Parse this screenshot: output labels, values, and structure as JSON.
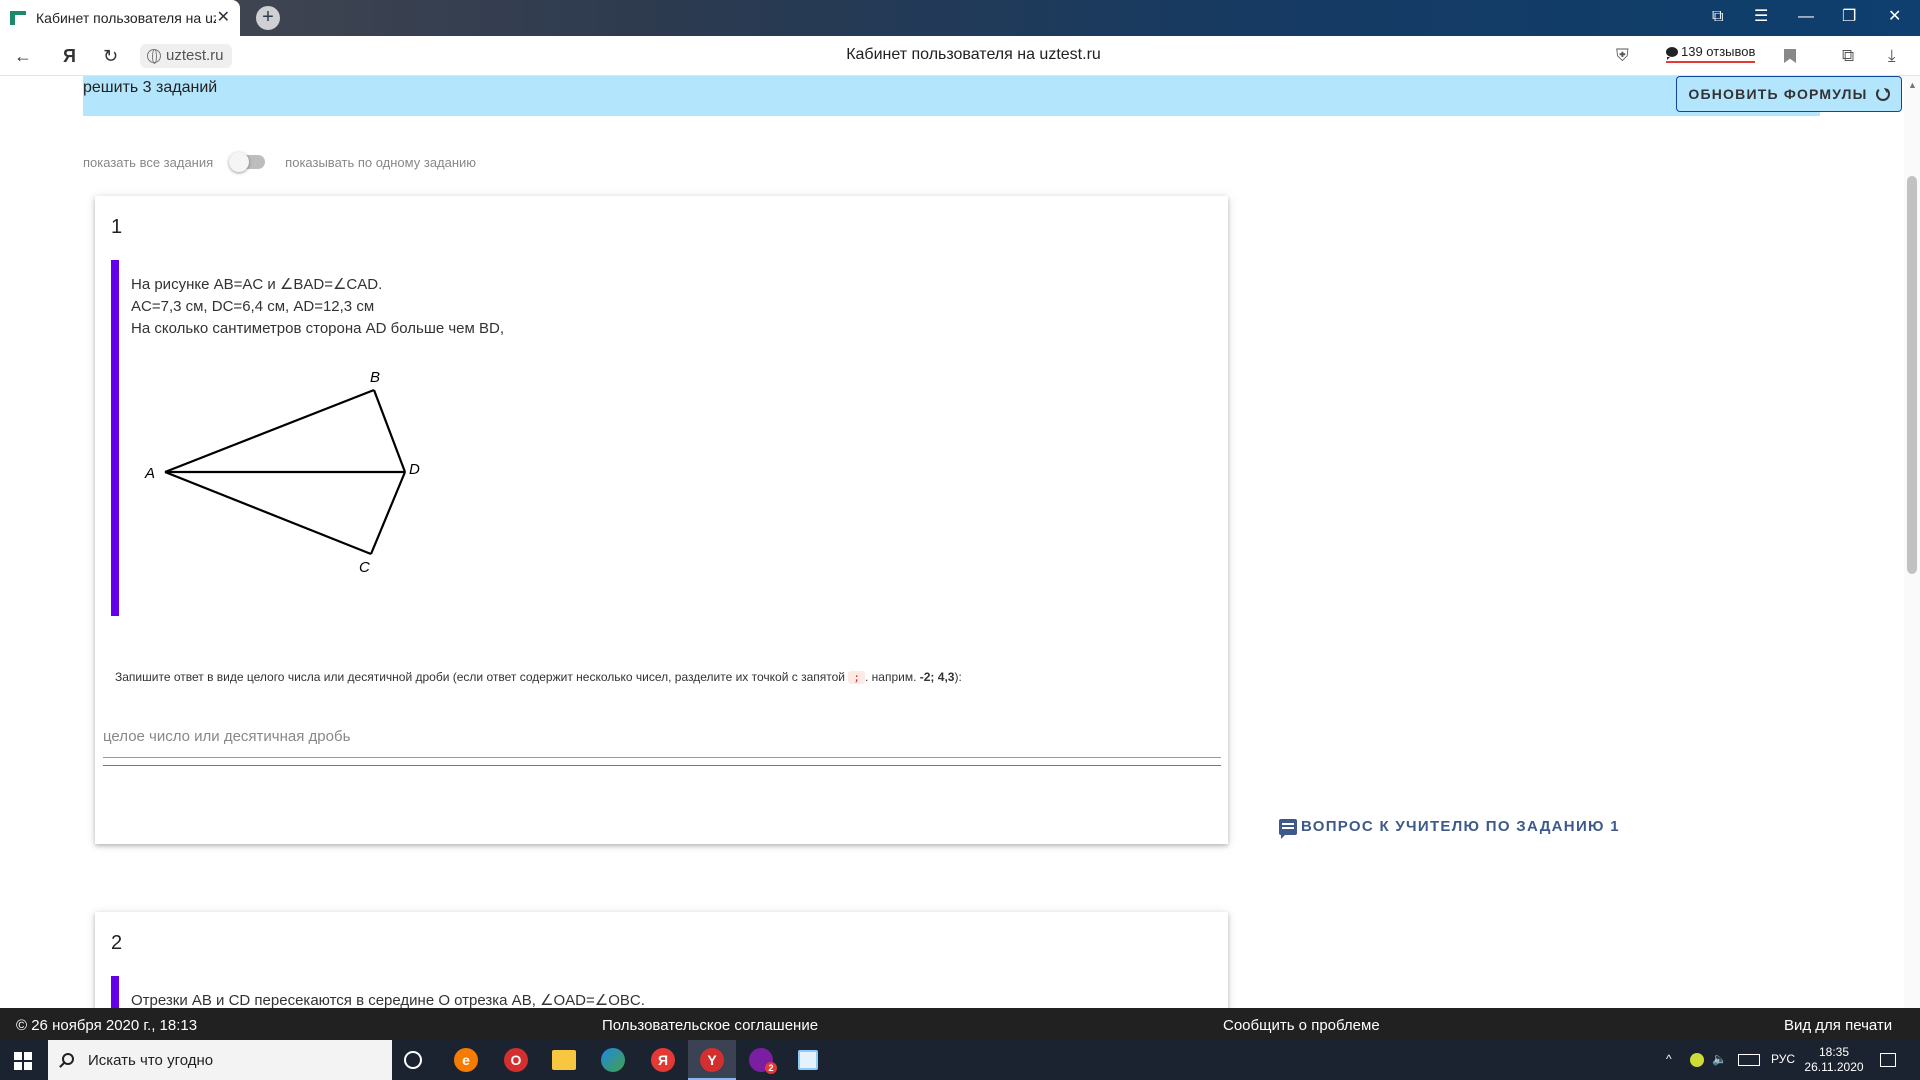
{
  "browser": {
    "tab_title": "Кабинет пользователя на uztest.ru",
    "tab_close": "✕",
    "new_tab": "+",
    "page_heading": "Кабинет пользователя на uztest.ru",
    "url": "uztest.ru",
    "back": "←",
    "yandex": "Я",
    "reload": "↻",
    "reviews": "139 отзывов",
    "window_controls": {
      "collections": "⧉",
      "menu": "☰",
      "minimize": "—",
      "restore": "❐",
      "close": "✕"
    },
    "download": "⤓"
  },
  "banner": {
    "text": "решить 3 заданий",
    "refresh_button": "ОБНОВИТЬ ФОРМУЛЫ"
  },
  "view_toggle": {
    "left_label": "показать все задания",
    "right_label": "показывать по одному заданию"
  },
  "tasks": [
    {
      "number": "1",
      "lines": [
        "На рисунке AB=AC и ∠BAD=∠CAD.",
        "AC=7,3 см, DC=6,4 см, AD=12,3 см",
        "На сколько сантиметров сторона AD больше чем BD,"
      ],
      "figure_labels": {
        "a": "A",
        "b": "B",
        "c": "C",
        "d": "D"
      },
      "hint_prefix": "Запишите ответ в виде целого числа или десятичной дроби (если ответ содержит несколько чисел, разделите их точкой с запятой",
      "hint_chip": ";",
      "hint_mid": ". наприм.",
      "hint_example": "-2; 4,3",
      "hint_suffix": "):",
      "answer_placeholder": "целое число или десятичная дробь",
      "answer_value": ""
    },
    {
      "number": "2",
      "lines": [
        "Отрезки AB и CD пересекаются в середине O отрезка AB, ∠OAD=∠OBC."
      ]
    }
  ],
  "ask_teacher": "ВОПРОС К УЧИТЕЛЮ ПО ЗАДАНИЮ 1",
  "footer": {
    "date": "© 26 ноября 2020 г., 18:13",
    "agreement": "Пользовательское соглашение",
    "report": "Сообщить о проблеме",
    "print": "Вид для печати"
  },
  "taskbar": {
    "search_placeholder": "Искать что угодно",
    "lang": "РУС",
    "time": "18:35",
    "date": "26.11.2020",
    "viber_badge": "2",
    "apps": {
      "edge_legacy": "e",
      "opera": "O",
      "yandex": "Я",
      "yandex_browser": "Y"
    }
  },
  "colors": {
    "banner_bg": "#b3e5fc",
    "task_accent": "#6200ea",
    "link": "#3d5a8a",
    "footer_bg": "#212121"
  }
}
